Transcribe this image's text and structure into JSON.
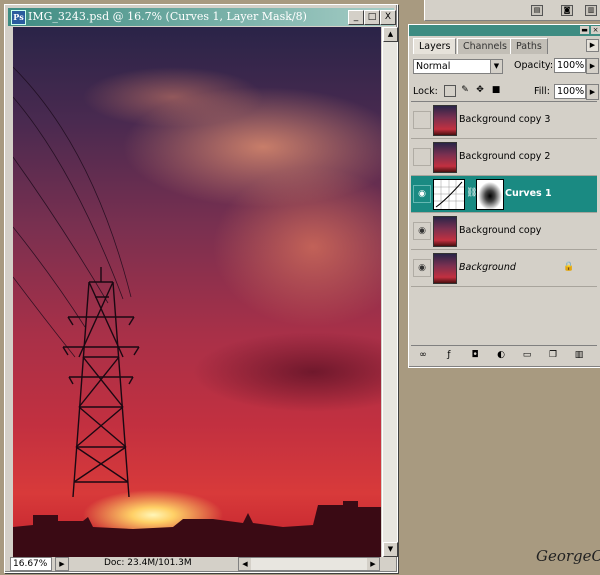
{
  "document": {
    "title": "IMG_3243.psd @ 16.7% (Curves 1, Layer Mask/8)",
    "ps_icon": "photoshop-icon",
    "window_buttons": {
      "minimize": "_",
      "maximize": "□",
      "close": "X"
    },
    "zoom": "16.67%",
    "doc_info": "Doc: 23.4M/101.3M"
  },
  "layers_panel": {
    "tabs": [
      "Layers",
      "Channels",
      "Paths"
    ],
    "blend_mode": "Normal",
    "opacity_label": "Opacity:",
    "opacity_value": "100%",
    "lock_label": "Lock:",
    "fill_label": "Fill:",
    "fill_value": "100%",
    "layers": [
      {
        "name": "Background copy 3",
        "visible": false,
        "selected": false
      },
      {
        "name": "Background copy 2",
        "visible": false,
        "selected": false
      },
      {
        "name": "Curves 1",
        "visible": true,
        "selected": true,
        "type": "adjustment-with-mask"
      },
      {
        "name": "Background copy",
        "visible": true,
        "selected": false
      },
      {
        "name": "Background",
        "visible": true,
        "selected": false,
        "locked": true
      }
    ],
    "footer_icons": [
      "link-layers-icon",
      "layer-style-icon",
      "layer-mask-icon",
      "adjustment-layer-icon",
      "new-group-icon",
      "new-layer-icon",
      "trash-icon"
    ]
  },
  "colors": {
    "title_bar": "#3e8c82",
    "selected_layer": "#1a8a82",
    "workspace": "#a89a80"
  },
  "signature": "GeorgeC"
}
